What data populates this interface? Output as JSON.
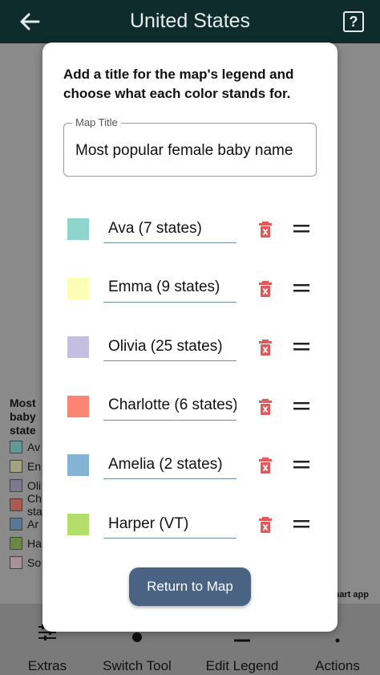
{
  "topbar": {
    "title": "United States",
    "help_label": "?"
  },
  "background": {
    "legend_title": "Most baby state",
    "legend_rows": [
      {
        "label": "Av",
        "color": "#5f9a94"
      },
      {
        "label": "En",
        "color": "#a3a37f"
      },
      {
        "label": "Oli",
        "color": "#7e7a8d"
      },
      {
        "label": "Ch sta",
        "color": "#a95a51"
      },
      {
        "label": "Ar",
        "color": "#5b7893"
      },
      {
        "label": "Ha",
        "color": "#6a8a44"
      },
      {
        "label": "So",
        "color": "#a8919c"
      }
    ],
    "credit": "hart app"
  },
  "bottombar": {
    "items": [
      {
        "label": "Extras",
        "icon": "sliders-icon"
      },
      {
        "label": "Switch Tool",
        "icon": "tool-icon"
      },
      {
        "label": "Edit Legend",
        "icon": "list-icon"
      },
      {
        "label": "Actions",
        "icon": "more-icon"
      }
    ]
  },
  "modal": {
    "heading": "Add a title for the map's legend and choose what each color stands for.",
    "title_field": {
      "label": "Map Title",
      "value": "Most popular female baby name"
    },
    "entries": [
      {
        "label": "Ava (7 states)",
        "color": "#8fd5cd"
      },
      {
        "label": "Emma (9 states)",
        "color": "#fdfdb6"
      },
      {
        "label": "Olivia (25 states)",
        "color": "#c4bfdf"
      },
      {
        "label": "Charlotte (6 states)",
        "color": "#fb8472"
      },
      {
        "label": "Amelia (2 states)",
        "color": "#84b3d5"
      },
      {
        "label": "Harper (VT)",
        "color": "#b3de6b"
      }
    ],
    "return_label": "Return to Map"
  },
  "colors": {
    "accent": "#4b6383",
    "delete": "#e05a5a",
    "topbar": "#0f2c2c"
  }
}
